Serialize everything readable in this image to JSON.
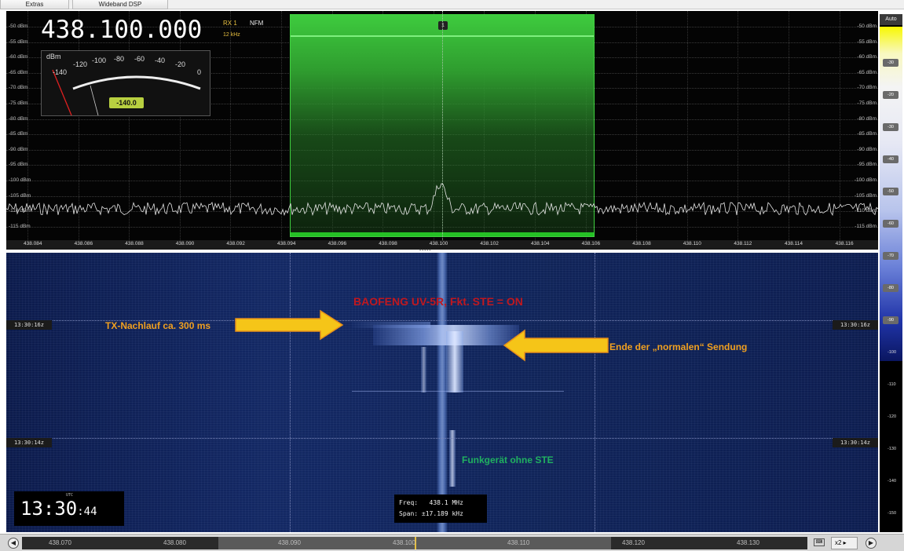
{
  "tabs": {
    "extras": "Extras",
    "wideband": "Wideband DSP"
  },
  "spectrum": {
    "frequency_display": "438.100.000",
    "rx": "RX 1",
    "mode": "NFM",
    "bandwidth": "12 kHz",
    "vfo_marker": "1",
    "db_labels_left": [
      "-50 dBm",
      "-55 dBm",
      "-60 dBm",
      "-65 dBm",
      "-70 dBm",
      "-75 dBm",
      "-80 dBm",
      "-85 dBm",
      "-90 dBm",
      "-95 dBm",
      "-100 dBm",
      "-105 dBm",
      "-110 dBm",
      "-115 dBm"
    ],
    "db_labels_right": [
      "-50 dBm",
      "-55 dBm",
      "-60 dBm",
      "-65 dBm",
      "-70 dBm",
      "-75 dBm",
      "-80 dBm",
      "-85 dBm",
      "-90 dBm",
      "-95 dBm",
      "-100 dBm",
      "-105 dBm",
      "-110 dBm",
      "-115 dBm"
    ],
    "freq_axis": [
      "438.084",
      "438.086",
      "438.088",
      "438.090",
      "438.092",
      "438.094",
      "438.096",
      "438.098",
      "438.100",
      "438.102",
      "438.104",
      "438.106",
      "438.108",
      "438.110",
      "438.112",
      "438.114",
      "438.116"
    ]
  },
  "smeter": {
    "unit": "dBm",
    "scale": [
      "-140",
      "-120",
      "-100",
      "-80",
      "-60",
      "-40",
      "-20",
      "0"
    ],
    "value": "-140.0"
  },
  "waterfall": {
    "time_top": "13:30:16z",
    "time_bottom": "13:30:14z",
    "annotation_title": "BAOFENG UV-5R,  Fkt. STE = ON",
    "annotation_tx": "TX-Nachlauf ca. 300 ms",
    "annotation_end": "Ende der „normalen“ Sendung",
    "annotation_green": "Funkgerät ohne STE",
    "clock_main": "13:30",
    "clock_sec": ":44",
    "clock_utc": "UTC",
    "freq_label": "Freq:",
    "freq_value": "438.1 MHz",
    "span_label": "Span:",
    "span_value": "±17.189 kHz"
  },
  "right_scale": {
    "auto": "Auto",
    "buttons": [
      "-30",
      "-20",
      "-30",
      "-40",
      "-50",
      "-60",
      "-70",
      "-80",
      "-90"
    ],
    "ticks": [
      "-100",
      "-110",
      "-120",
      "-130",
      "-140",
      "-150"
    ]
  },
  "bottom": {
    "overview_labels": [
      "438.070",
      "438.080",
      "438.090",
      "438.100",
      "438.110",
      "438.120",
      "438.130"
    ],
    "zoom": "x2"
  },
  "colors": {
    "waterfall_bg": "#0c1b4c",
    "filter_green": "#3ecb3e",
    "annotation_red": "#c0181f",
    "annotation_orange": "#f0a020",
    "annotation_green": "#20b060"
  }
}
